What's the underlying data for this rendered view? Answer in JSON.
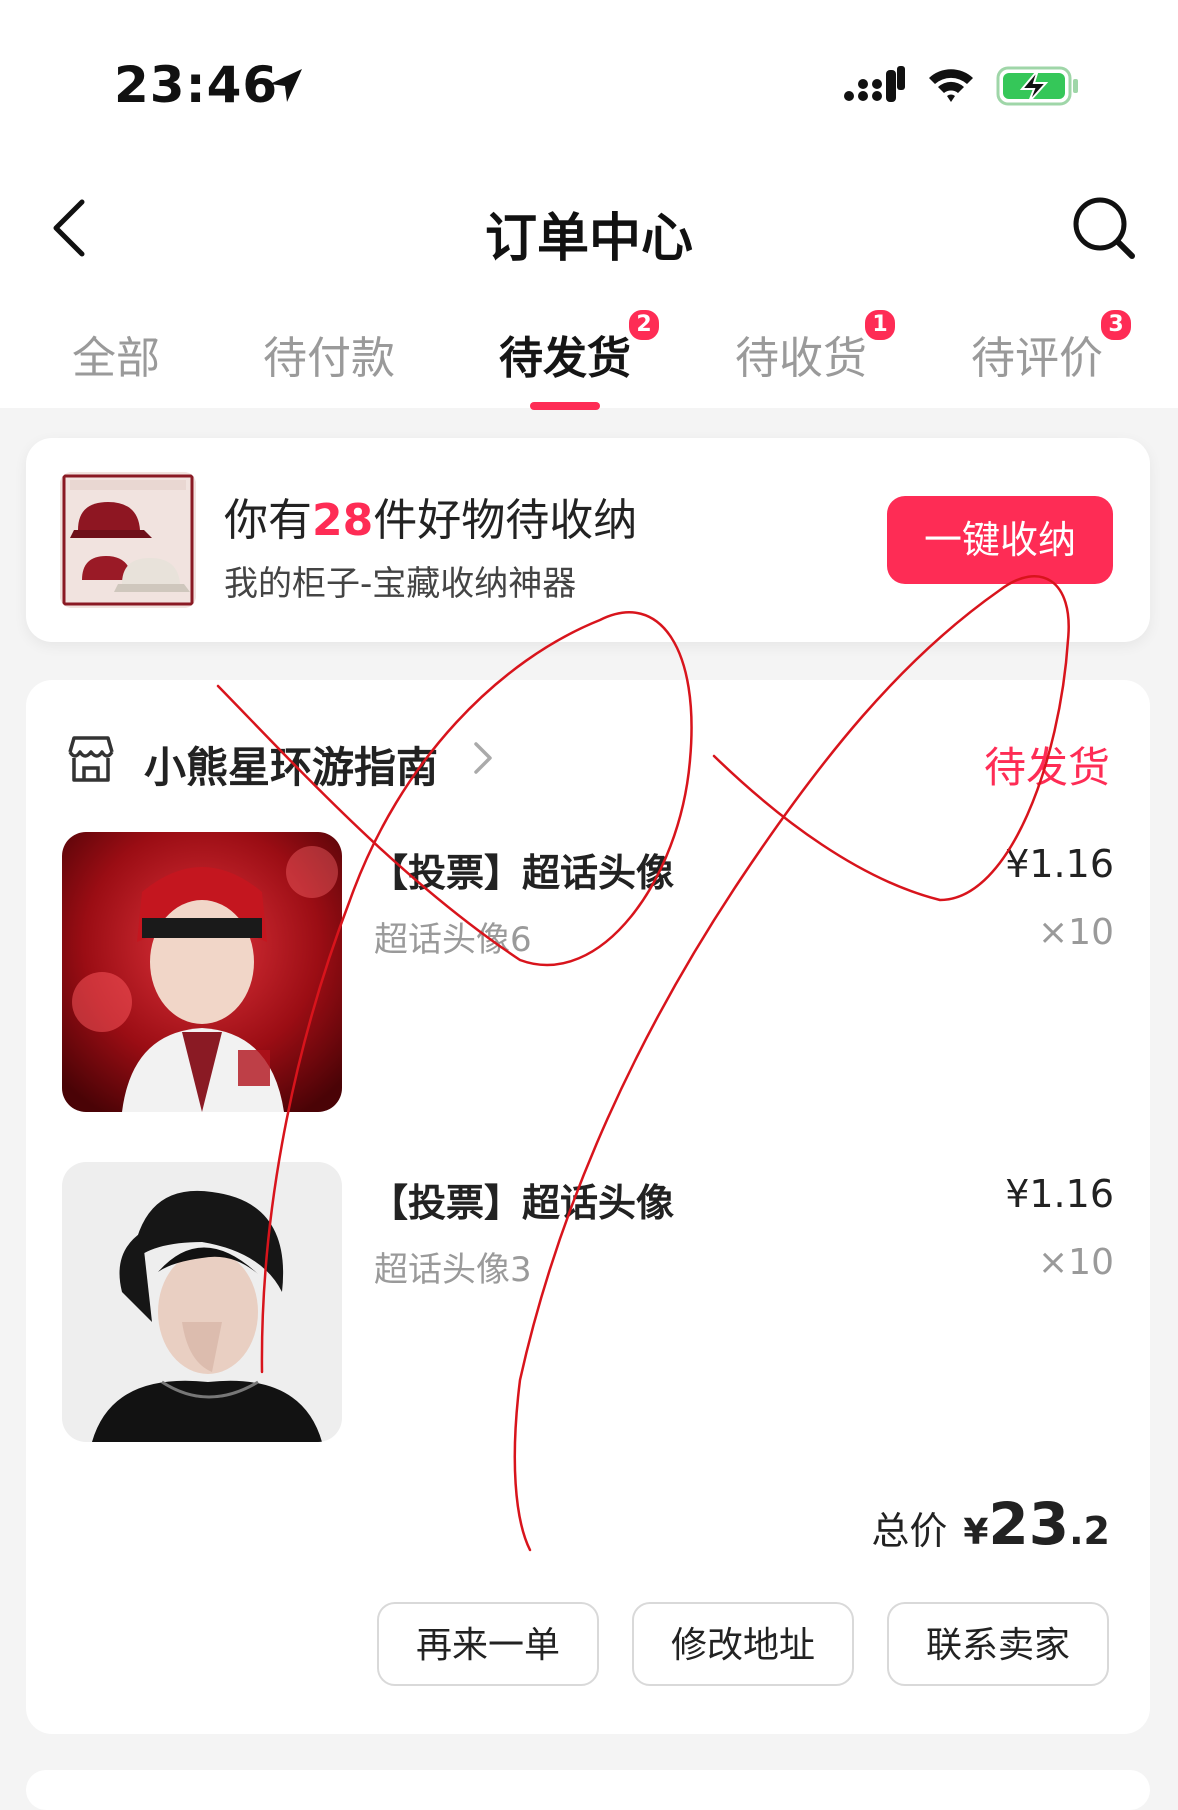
{
  "status_bar": {
    "time": "23:46"
  },
  "header": {
    "title": "订单中心"
  },
  "tabs": [
    {
      "label": "全部",
      "badge": ""
    },
    {
      "label": "待付款",
      "badge": ""
    },
    {
      "label": "待发货",
      "badge": "2",
      "active": true
    },
    {
      "label": "待收货",
      "badge": "1"
    },
    {
      "label": "待评价",
      "badge": "3"
    }
  ],
  "promo": {
    "headline_prefix": "你有",
    "headline_count": "28",
    "headline_suffix": "件好物待收纳",
    "subtitle": "我的柜子-宝藏收纳神器",
    "button_label": "一键收纳"
  },
  "order": {
    "shop_name": "小熊星环游指南",
    "status": "待发货",
    "items": [
      {
        "title": "【投票】超话头像",
        "spec": "超话头像6",
        "price": "¥1.16",
        "qty": "×10"
      },
      {
        "title": "【投票】超话头像",
        "spec": "超话头像3",
        "price": "¥1.16",
        "qty": "×10"
      }
    ],
    "total_label": "总价",
    "total_currency": "¥",
    "total_int": "23",
    "total_dec": ".2",
    "actions": [
      "再来一单",
      "修改地址",
      "联系卖家"
    ]
  },
  "colors": {
    "accent": "#fe2c55",
    "battery_green": "#35c759",
    "annotation": "#d8141c"
  }
}
